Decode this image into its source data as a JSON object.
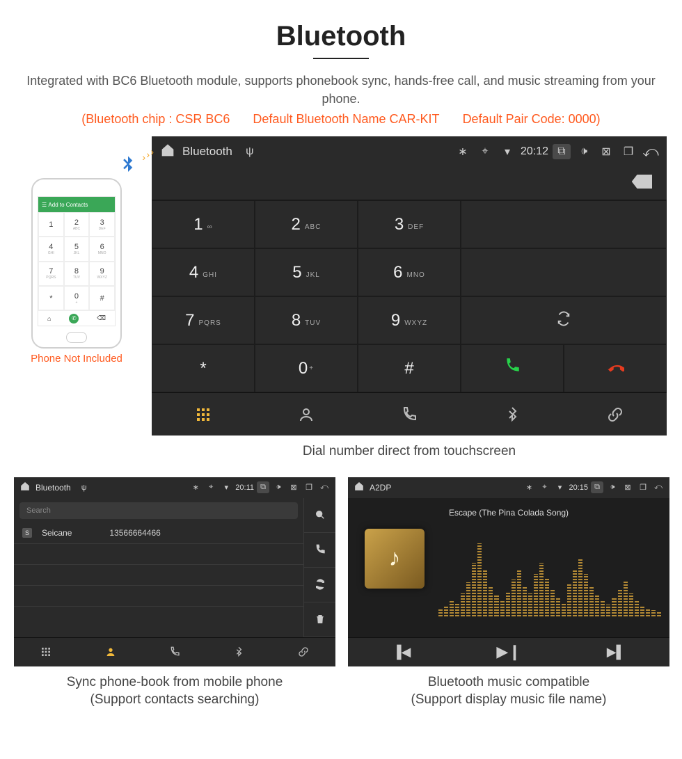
{
  "header": {
    "title": "Bluetooth",
    "description": "Integrated with BC6 Bluetooth module, supports phonebook sync, hands-free call, and music streaming from your phone.",
    "spec_chip": "(Bluetooth chip : CSR BC6",
    "spec_name": "Default Bluetooth Name CAR-KIT",
    "spec_code": "Default Pair Code: 0000)"
  },
  "phone_note": "Phone Not Included",
  "phone_mock": {
    "topbar": "Add to Contacts",
    "keys": [
      {
        "n": "1",
        "l": ""
      },
      {
        "n": "2",
        "l": "ABC"
      },
      {
        "n": "3",
        "l": "DEF"
      },
      {
        "n": "4",
        "l": "GHI"
      },
      {
        "n": "5",
        "l": "JKL"
      },
      {
        "n": "6",
        "l": "MNO"
      },
      {
        "n": "7",
        "l": "PQRS"
      },
      {
        "n": "8",
        "l": "TUV"
      },
      {
        "n": "9",
        "l": "WXYZ"
      },
      {
        "n": "*",
        "l": ""
      },
      {
        "n": "0",
        "l": "+"
      },
      {
        "n": "#",
        "l": ""
      }
    ]
  },
  "dialer": {
    "app_title": "Bluetooth",
    "time": "20:12",
    "keys": [
      {
        "n": "1",
        "l": "∞"
      },
      {
        "n": "2",
        "l": "ABC"
      },
      {
        "n": "3",
        "l": "DEF"
      },
      {
        "n": "4",
        "l": "GHI"
      },
      {
        "n": "5",
        "l": "JKL"
      },
      {
        "n": "6",
        "l": "MNO"
      },
      {
        "n": "7",
        "l": "PQRS"
      },
      {
        "n": "8",
        "l": "TUV"
      },
      {
        "n": "9",
        "l": "WXYZ"
      },
      {
        "n": "*",
        "l": ""
      },
      {
        "n": "0",
        "l": "+"
      },
      {
        "n": "#",
        "l": ""
      }
    ],
    "caption": "Dial number direct from touchscreen"
  },
  "phonebook": {
    "app_title": "Bluetooth",
    "time": "20:11",
    "search_placeholder": "Search",
    "contact_name": "Seicane",
    "contact_number": "13566664466",
    "badge": "S",
    "caption_line1": "Sync phone-book from mobile phone",
    "caption_line2": "(Support contacts searching)"
  },
  "music": {
    "app_title": "A2DP",
    "time": "20:15",
    "track": "Escape (The Pina Colada Song)",
    "caption_line1": "Bluetooth music compatible",
    "caption_line2": "(Support display music file name)"
  }
}
